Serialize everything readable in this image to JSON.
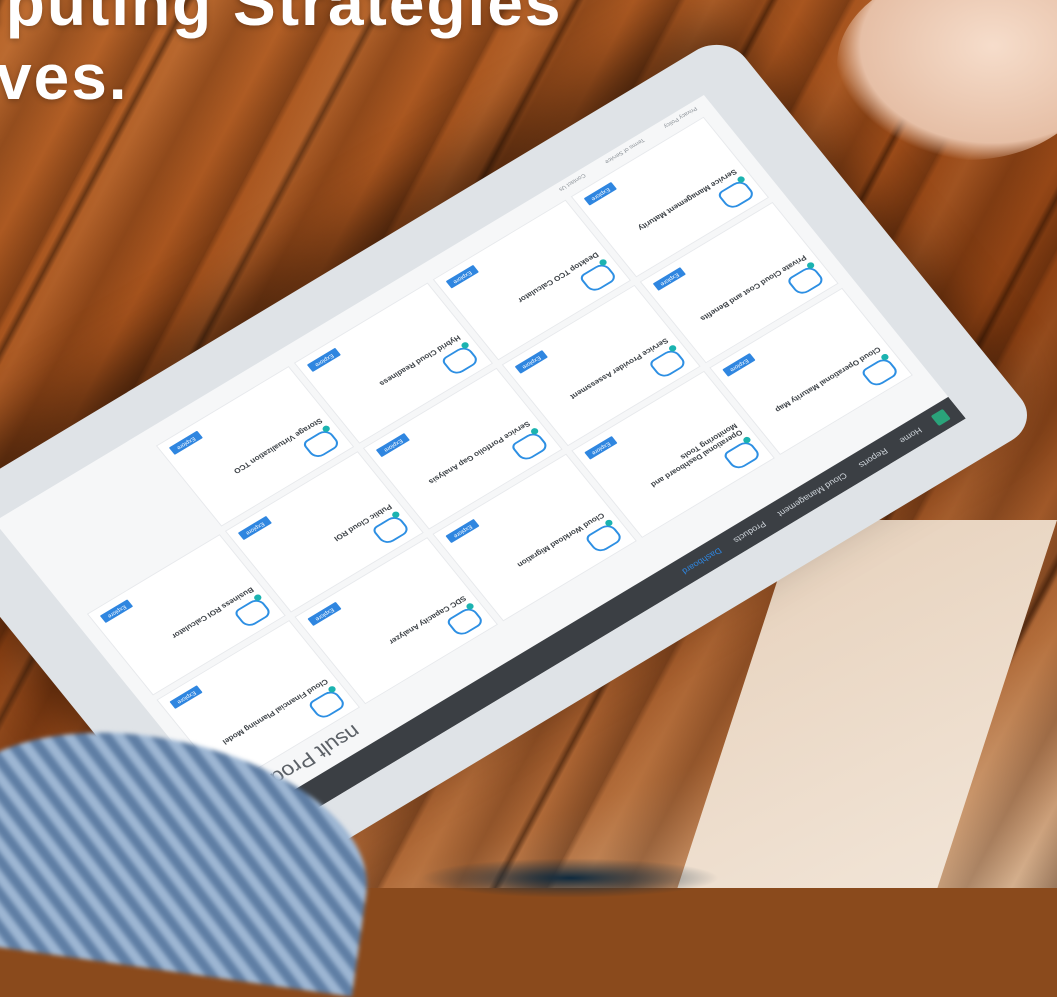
{
  "headline": {
    "line1": "iputing Strategies",
    "line2": "ves."
  },
  "app": {
    "nav": [
      "Home",
      "Reports",
      "Cloud Management",
      "Products",
      "Dashboard"
    ],
    "active_nav": "Dashboard",
    "page_title": "nsult  Products"
  },
  "cards": [
    {
      "title": "Cloud Operational Maturity Map",
      "button": "Explore"
    },
    {
      "title": "Operational Dashboard and Monitoring Tools",
      "button": "Explore"
    },
    {
      "title": "Cloud Workload Migration",
      "button": "Explore"
    },
    {
      "title": "SDC Capacity Analyzer",
      "button": "Explore"
    },
    {
      "title": "Cloud Financial Planning Model",
      "button": "Explore"
    },
    {
      "title": "Private Cloud Cost and Benefits",
      "button": "Explore"
    },
    {
      "title": "Service Provider Assessment",
      "button": "Explore"
    },
    {
      "title": "Service Portfolio Gap Analysis",
      "button": "Explore"
    },
    {
      "title": "Public Cloud ROI",
      "button": "Explore"
    },
    {
      "title": "Business ROI Calculator",
      "button": "Explore"
    },
    {
      "title": "Service Management Maturity",
      "button": "Explore"
    },
    {
      "title": "Desktop TCO Calculator",
      "button": "Explore"
    },
    {
      "title": "Hybrid Cloud Readiness",
      "button": "Explore"
    },
    {
      "title": "Storage Virtualization TCO",
      "button": "Explore"
    }
  ],
  "footer": [
    "Privacy Policy",
    "Terms of Service",
    "Contact Us"
  ]
}
